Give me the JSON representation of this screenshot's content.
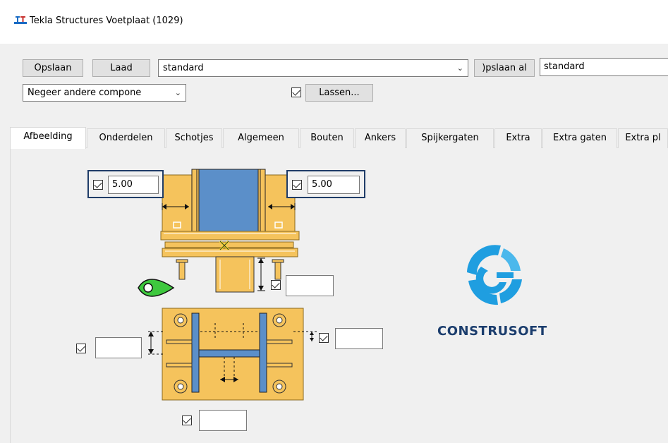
{
  "window": {
    "title": "Tekla Structures  Voetplaat (1029)"
  },
  "toolbar": {
    "save_label": "Opslaan",
    "load_label": "Laad",
    "preset_value": "standard",
    "save_as_label": ")pslaan al",
    "save_as_value": "standard",
    "filter_value": "Negeer andere compone",
    "welds_checked": true,
    "welds_label": "Lassen..."
  },
  "tabs": [
    {
      "label": "Afbeelding",
      "active": true
    },
    {
      "label": "Onderdelen"
    },
    {
      "label": "Schotjes"
    },
    {
      "label": "Algemeen"
    },
    {
      "label": "Bouten"
    },
    {
      "label": "Ankers"
    },
    {
      "label": "Spijkergaten"
    },
    {
      "label": "Extra"
    },
    {
      "label": "Extra gaten"
    },
    {
      "label": "Extra pl"
    }
  ],
  "picture": {
    "weld_left_value": "5.00",
    "weld_right_value": "5.00",
    "shaft_value": "",
    "left_value": "",
    "right_value": "",
    "bottom_value": ""
  },
  "logo": {
    "text": "CONSTRUSOFT"
  },
  "colors": {
    "plate": "#f5c35c",
    "plate_dark": "#e0a838",
    "column": "#5b8fc9",
    "highlight_border": "#1f3c68",
    "logo_blue": "#1f9ee0",
    "logo_text": "#1b3d6d",
    "weld_mark": "#f5e41e",
    "green_symbol": "#1ea81e"
  }
}
